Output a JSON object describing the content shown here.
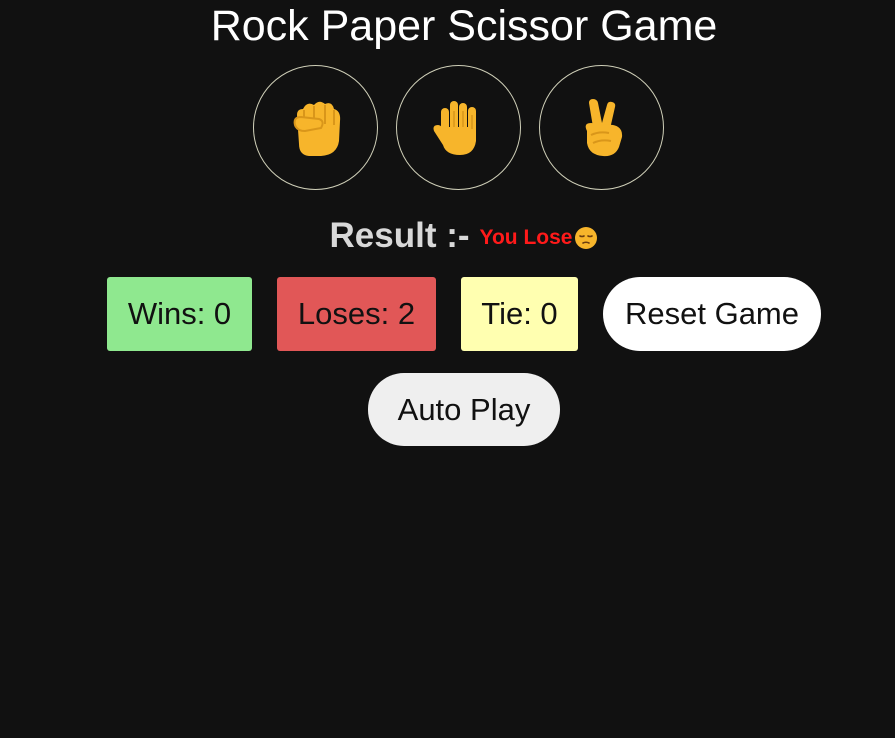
{
  "title": "Rock Paper Scissor Game",
  "choices": [
    {
      "name": "rock",
      "icon": "raised-fist-icon"
    },
    {
      "name": "paper",
      "icon": "raised-hand-icon"
    },
    {
      "name": "scissors",
      "icon": "victory-hand-icon"
    }
  ],
  "result": {
    "label": "Result :-",
    "text": "You Lose",
    "icon": "pensive-face-icon",
    "text_color": "#ff1a1a"
  },
  "stats": {
    "wins": "Wins: 0",
    "loses": "Loses: 2",
    "tie": "Tie: 0"
  },
  "buttons": {
    "reset": "Reset Game",
    "auto_play": "Auto Play"
  },
  "colors": {
    "background": "#111111",
    "wins": "#8fe88f",
    "loses": "#e15757",
    "tie": "#ffffb0",
    "emoji": "#f7b52b"
  }
}
